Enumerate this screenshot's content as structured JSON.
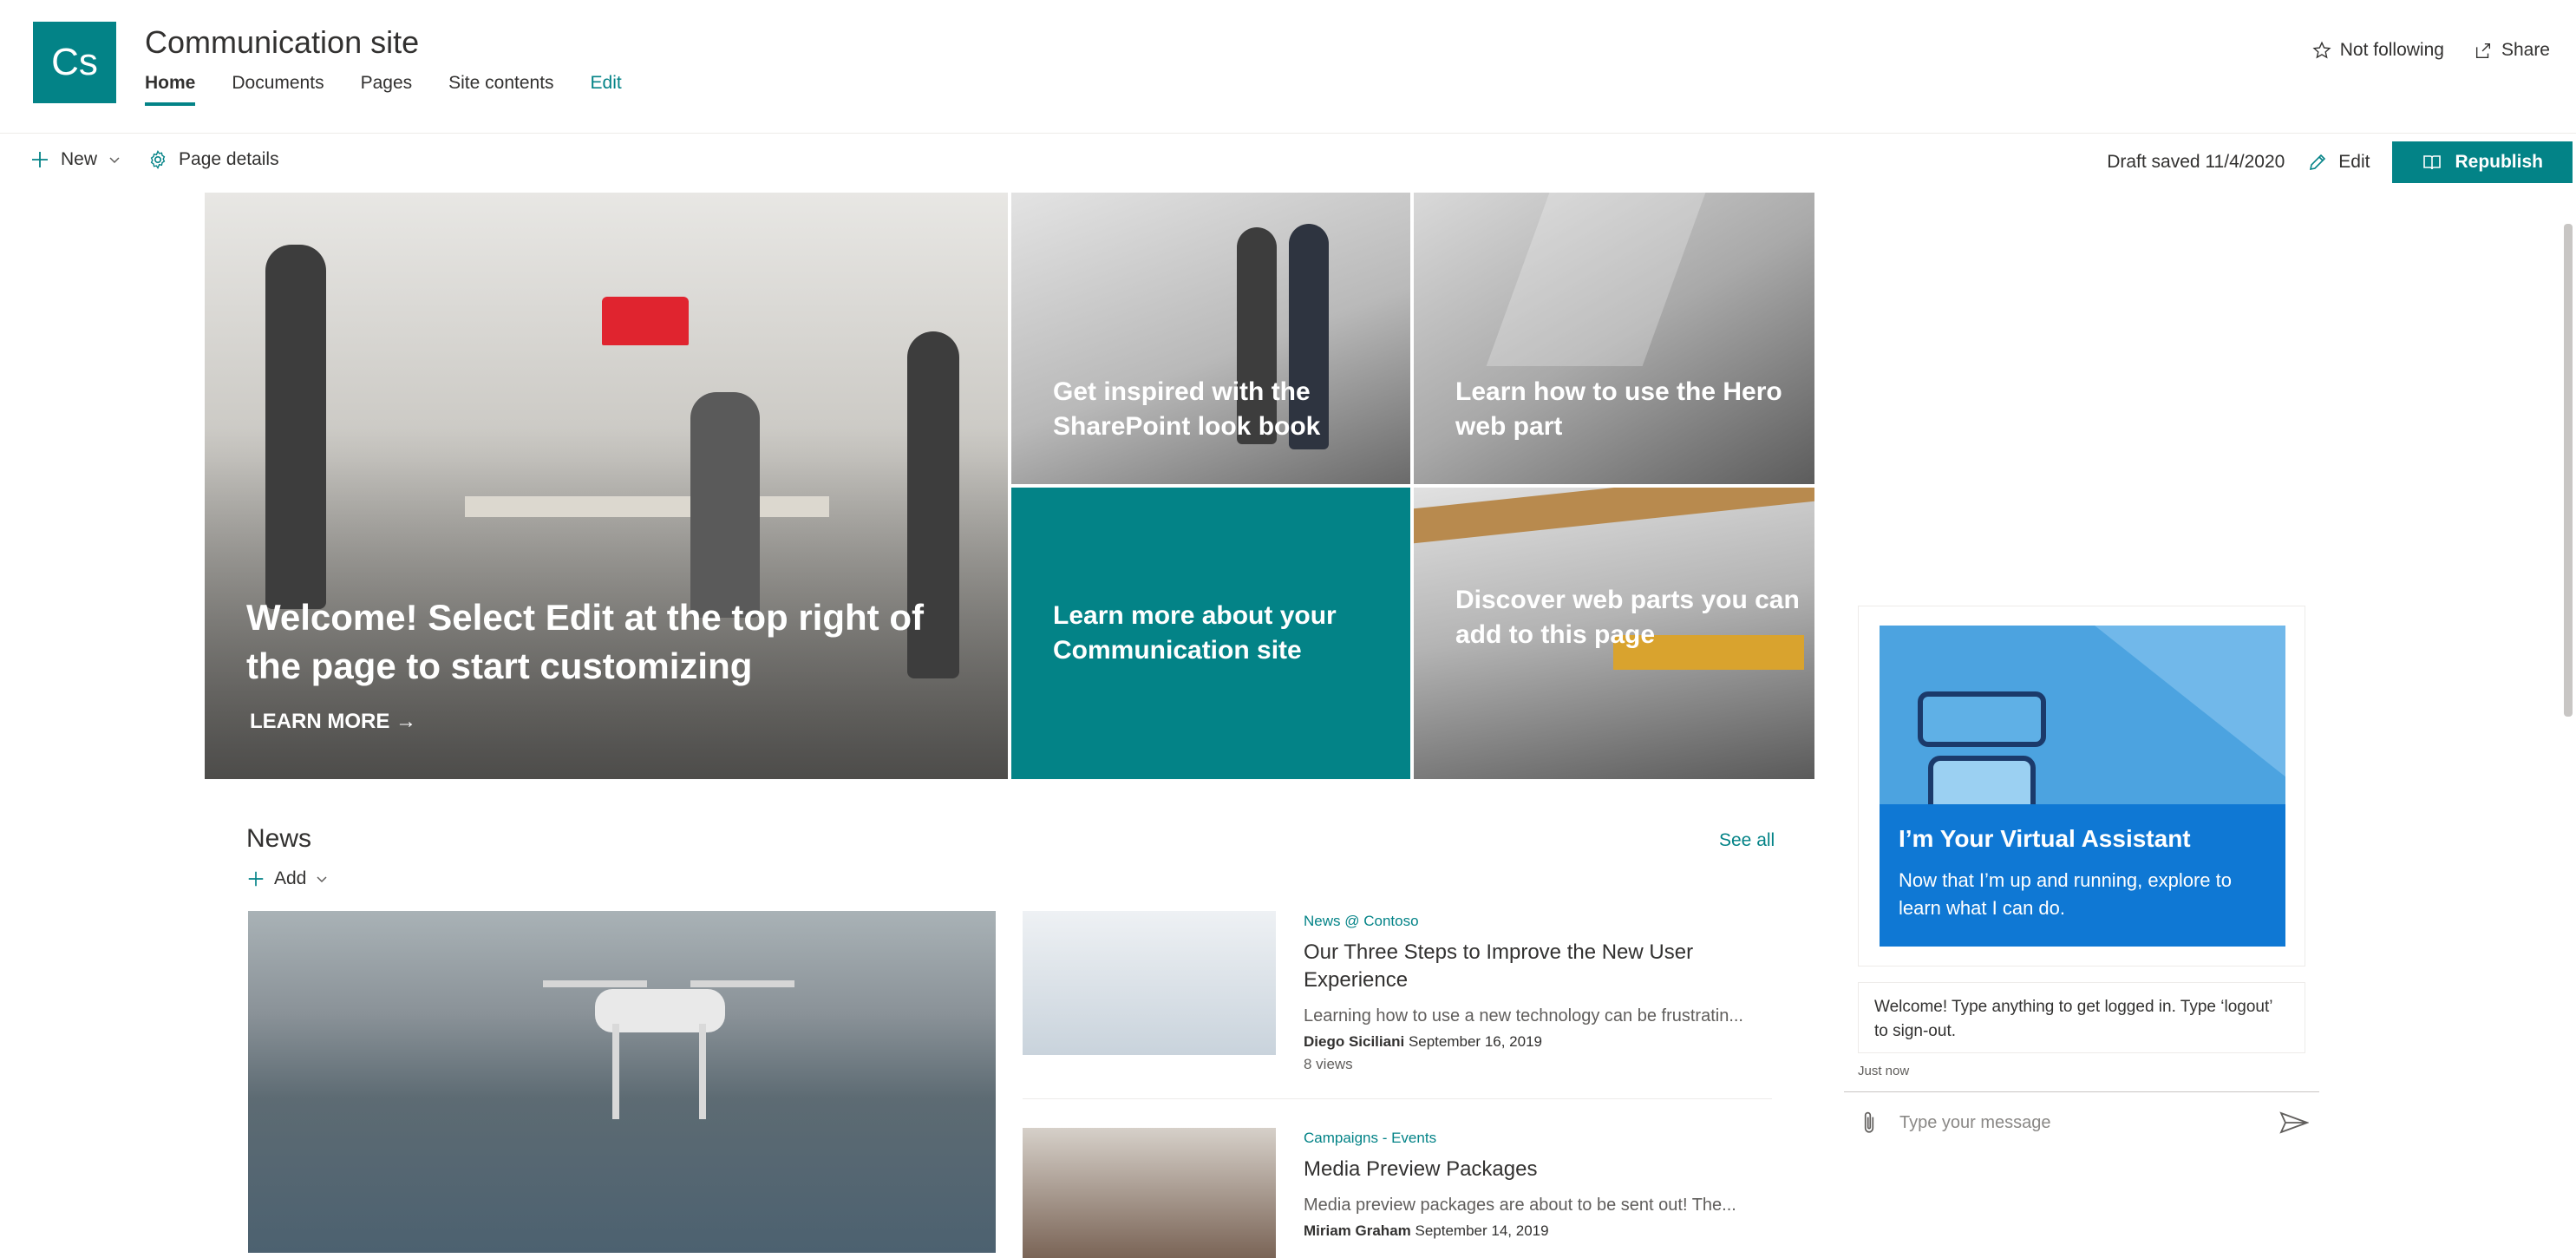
{
  "site": {
    "logo_text": "Cs",
    "title": "Communication site",
    "nav": [
      {
        "label": "Home"
      },
      {
        "label": "Documents"
      },
      {
        "label": "Pages"
      },
      {
        "label": "Site contents"
      },
      {
        "label": "Edit"
      }
    ],
    "follow_label": "Not following",
    "share_label": "Share"
  },
  "commandbar": {
    "new_label": "New",
    "page_details_label": "Page details",
    "draft_status": "Draft saved 11/4/2020",
    "edit_label": "Edit",
    "republish_label": "Republish"
  },
  "hero": {
    "main_title": "Welcome! Select Edit at the top right of the page to start customizing",
    "main_link": "LEARN MORE →",
    "tile1": "Get inspired with the SharePoint look book",
    "tile2": "Learn how to use the Hero web part",
    "tile3": "Learn more about your Communication site",
    "tile4": "Discover web parts you can add to this page"
  },
  "news": {
    "title": "News",
    "see_all": "See all",
    "add_label": "Add",
    "items": [
      {
        "category": "News @ Contoso",
        "headline": "Our Three Steps to Improve the New User Experience",
        "desc": "Learning how to use a new technology can be frustratin...",
        "author": "Diego Siciliani",
        "date": "September 16, 2019",
        "views": "8 views"
      },
      {
        "category": "Campaigns - Events",
        "headline": "Media Preview Packages",
        "desc": "Media preview packages are about to be sent out! The...",
        "author": "Miriam Graham",
        "date": "September 14, 2019"
      }
    ]
  },
  "assistant": {
    "card_title": "I’m Your Virtual Assistant",
    "card_text": "Now that I’m up and running, explore to learn what I can do.",
    "message": "Welcome! Type anything to get logged in. Type ‘logout’ to sign-out.",
    "timestamp": "Just now",
    "input_placeholder": "Type your message"
  },
  "colors": {
    "brand": "#038387",
    "assistant_blue": "#0f78d4"
  }
}
